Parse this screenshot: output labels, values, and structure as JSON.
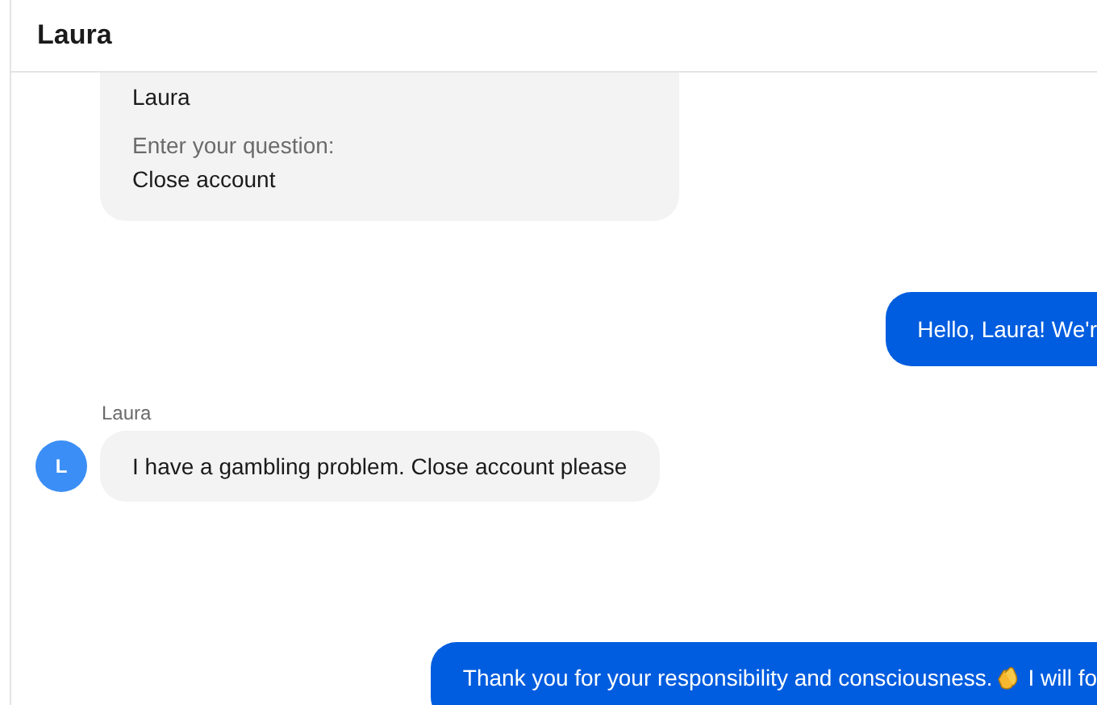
{
  "header": {
    "title": "Laura"
  },
  "messages": [
    {
      "kind": "form",
      "fields": [
        {
          "value": "Laura"
        },
        {
          "label": "Enter your question:",
          "value": "Close account"
        }
      ]
    },
    {
      "kind": "outgoing",
      "parts": [
        {
          "kind": "text",
          "text": "Hello, Laura! We'r"
        }
      ]
    },
    {
      "kind": "incoming",
      "sender": "Laura",
      "avatar": "L",
      "parts": [
        {
          "kind": "text",
          "text": "I have a gambling problem. Close account please"
        }
      ]
    },
    {
      "kind": "outgoing",
      "parts": [
        {
          "kind": "text",
          "text": "Thank you for your responsibility and consciousness."
        },
        {
          "kind": "clap"
        },
        {
          "kind": "text",
          "text": " I will fo"
        }
      ]
    }
  ]
}
